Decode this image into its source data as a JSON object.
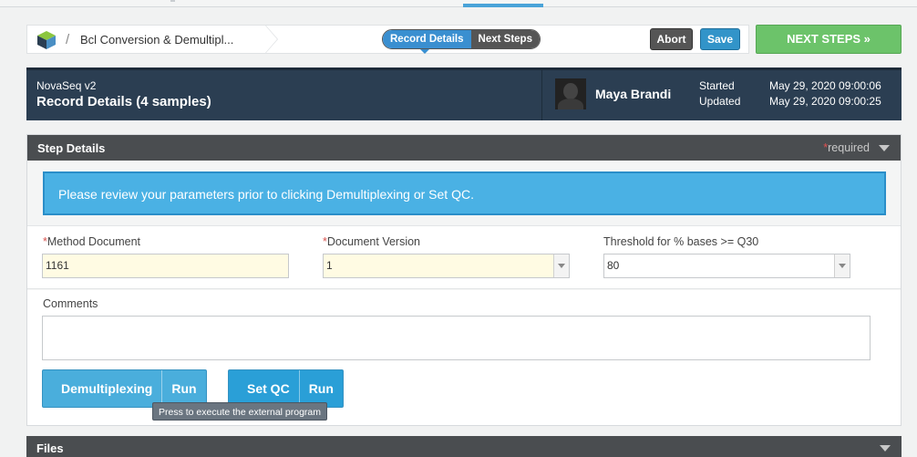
{
  "header": {
    "breadcrumb": "Bcl Conversion & Demultipl...",
    "toggle": {
      "record_details": "Record Details",
      "next_steps": "Next Steps"
    },
    "abort_label": "Abort",
    "save_label": "Save",
    "next_steps_label": "NEXT STEPS »"
  },
  "record": {
    "subtitle": "NovaSeq v2",
    "title": "Record Details (4 samples)",
    "user_name": "Maya Brandi",
    "started_label": "Started",
    "updated_label": "Updated",
    "started_value": "May 29, 2020 09:00:06",
    "updated_value": "May 29, 2020 09:00:25"
  },
  "step_details": {
    "title": "Step Details",
    "required_note": "required",
    "info_message": "Please review your parameters prior to clicking Demultiplexing or Set QC.",
    "fields": {
      "method_document": {
        "label": "Method Document",
        "value": "1161"
      },
      "document_version": {
        "label": "Document Version",
        "value": "1"
      },
      "threshold": {
        "label": "Threshold for % bases >= Q30",
        "value": "80"
      }
    },
    "comments_label": "Comments",
    "comments_value": "",
    "buttons": [
      {
        "label": "Demultiplexing",
        "run": "Run"
      },
      {
        "label": "Set QC",
        "run": "Run"
      }
    ],
    "tooltip": "Press to execute the external program"
  },
  "files": {
    "title": "Files"
  },
  "colors": {
    "accent_blue": "#4ab1e4",
    "next_green": "#6cc36a",
    "banner_navy": "#2b3e52",
    "panel_header": "#4a4d50",
    "required_red": "#d9534f"
  }
}
